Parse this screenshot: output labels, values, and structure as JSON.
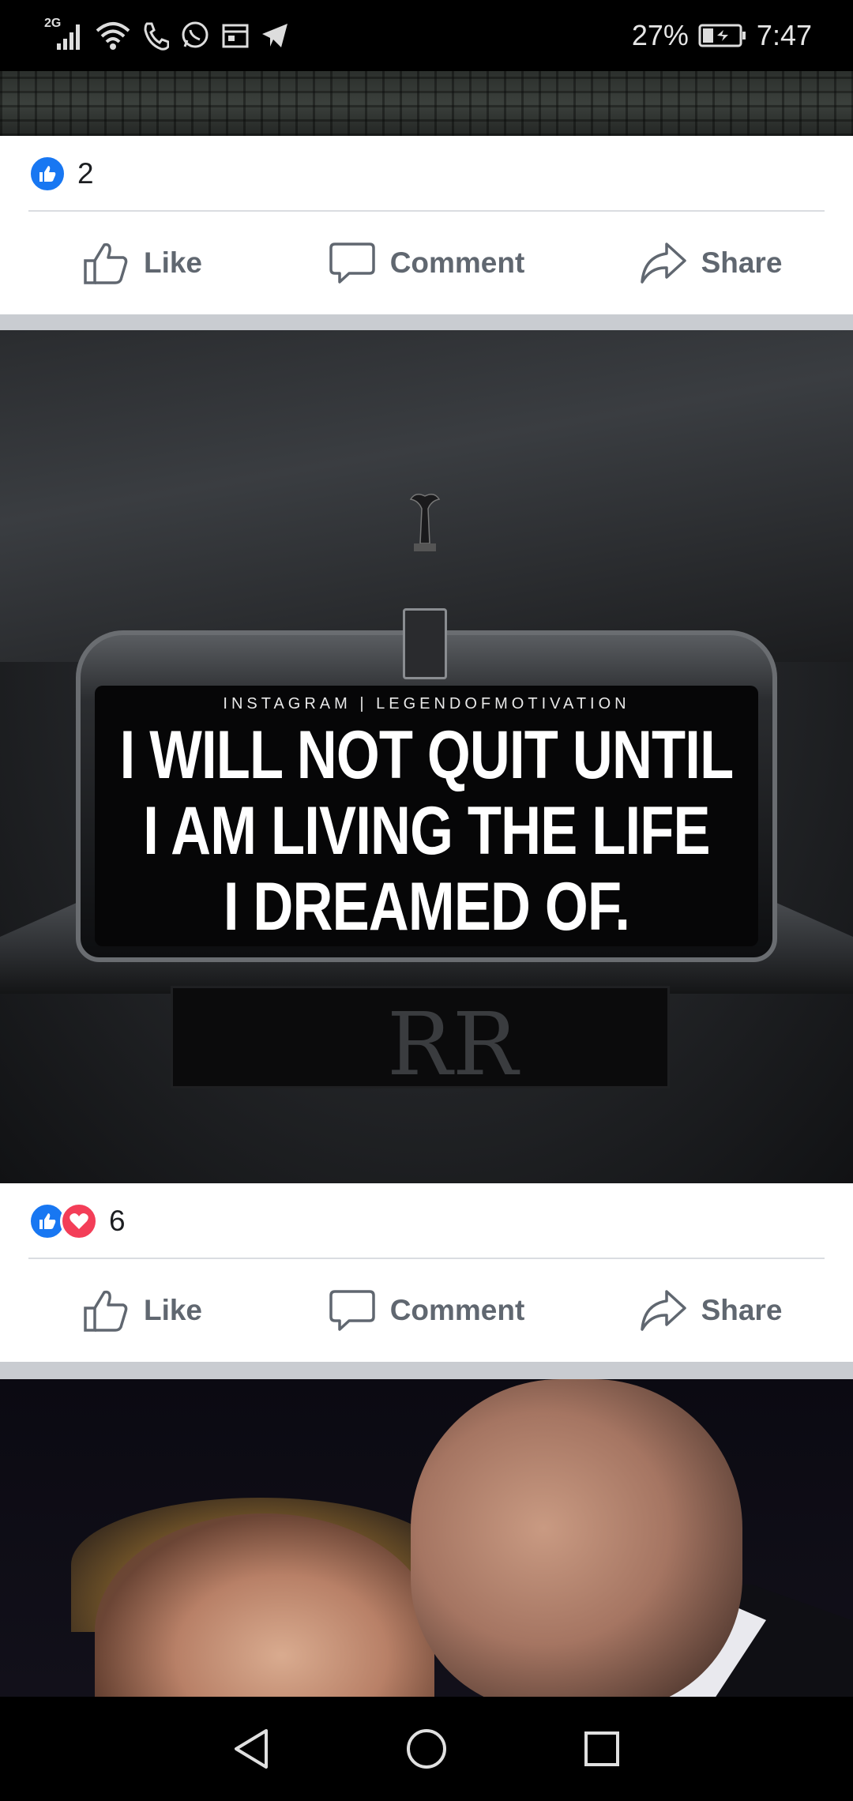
{
  "status_bar": {
    "network": "2G",
    "battery_percent": "27%",
    "time": "7:47",
    "icons": [
      "signal-icon",
      "wifi-icon",
      "call-icon",
      "whatsapp-icon",
      "calendar-icon",
      "telegram-icon",
      "battery-icon"
    ]
  },
  "posts": [
    {
      "reactions": {
        "types": [
          "like"
        ],
        "count": "2"
      },
      "actions": {
        "like": "Like",
        "comment": "Comment",
        "share": "Share"
      }
    },
    {
      "image": {
        "credit": "INSTAGRAM | LEGENDOFMOTIVATION",
        "quote_lines": [
          "I WILL NOT QUIT UNTIL",
          "I AM LIVING THE LIFE",
          "I DREAMED OF."
        ],
        "plate_text": "RR"
      },
      "reactions": {
        "types": [
          "like",
          "love"
        ],
        "count": "6"
      },
      "actions": {
        "like": "Like",
        "comment": "Comment",
        "share": "Share"
      }
    }
  ],
  "colors": {
    "like_blue": "#1877f2",
    "love_red": "#f33e58",
    "action_gray": "#606770",
    "feed_separator": "#c9ccd1"
  },
  "nav_bar": {
    "icons": [
      "back-icon",
      "home-icon",
      "recents-icon"
    ]
  }
}
